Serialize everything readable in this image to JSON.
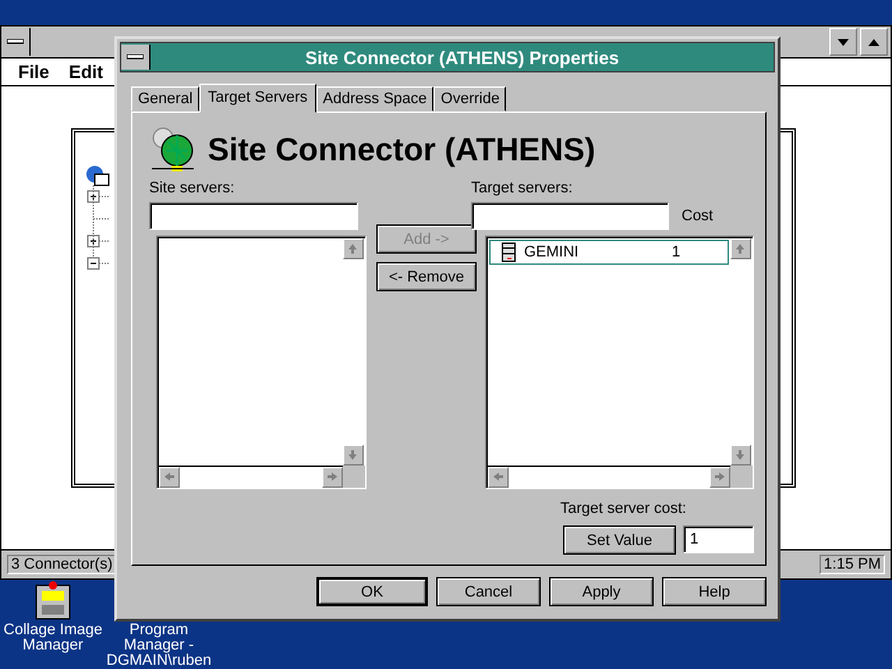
{
  "app_window": {
    "menu": [
      "File",
      "Edit"
    ],
    "status_bar": {
      "left": "3 Connector(s)",
      "right": "1:15 PM"
    }
  },
  "desktop_icons": [
    {
      "label": "Collage Image Manager",
      "kind": "cabinet"
    },
    {
      "label": "Program Manager - DGMAIN\\ruben",
      "kind": "hidden"
    }
  ],
  "dialog": {
    "title": "Site Connector (ATHENS) Properties",
    "tabs": [
      {
        "label": "General",
        "selected": false
      },
      {
        "label": "Target Servers",
        "selected": true
      },
      {
        "label": "Address Space",
        "selected": false
      },
      {
        "label": "Override",
        "selected": false
      }
    ],
    "heading": "Site Connector (ATHENS)",
    "site_servers": {
      "label": "Site servers:"
    },
    "add_button": {
      "label": "Add ->",
      "disabled": true
    },
    "remove_button": {
      "label": "<- Remove",
      "disabled": false
    },
    "target_servers": {
      "label": "Target servers:",
      "cost_header": "Cost",
      "rows": [
        {
          "name": "GEMINI",
          "cost": "1",
          "focused": true
        }
      ]
    },
    "cost_label": "Target server cost:",
    "set_value_button": "Set Value",
    "cost_value": "1",
    "buttons": [
      {
        "label": "OK",
        "default": true
      },
      {
        "label": "Cancel",
        "default": false
      },
      {
        "label": "Apply",
        "default": false
      },
      {
        "label": "Help",
        "default": false
      }
    ]
  }
}
